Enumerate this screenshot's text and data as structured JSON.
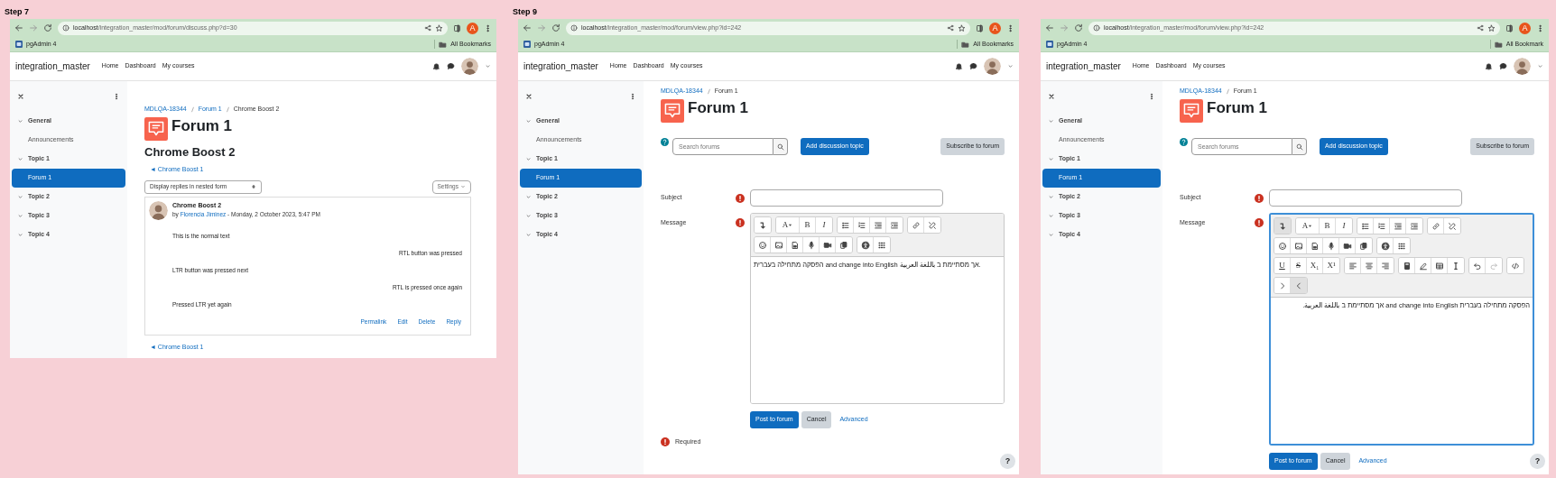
{
  "panels": [
    {
      "step_label": "Step 7",
      "browser": {
        "url_host": "localhost",
        "url_path": "/integration_master/mod/forum/discuss.php?d=30",
        "profile_initial": "A",
        "bookmark": "pgAdmin 4",
        "bookmarks_folder": "All Bookmarks"
      },
      "site": {
        "name": "integration_master",
        "nav": [
          "Home",
          "Dashboard",
          "My courses"
        ]
      },
      "sidebar": {
        "sections": [
          {
            "label": "General",
            "expanded": true,
            "children": [
              {
                "label": "Announcements",
                "selected": false
              }
            ]
          },
          {
            "label": "Topic 1",
            "expanded": true,
            "children": [
              {
                "label": "Forum 1",
                "selected": true
              }
            ]
          },
          {
            "label": "Topic 2",
            "expanded": true
          },
          {
            "label": "Topic 3",
            "expanded": true
          },
          {
            "label": "Topic 4",
            "expanded": true
          }
        ]
      },
      "breadcrumb": [
        {
          "label": "MDLQA-18344",
          "current": false
        },
        {
          "label": "Forum 1",
          "current": false
        },
        {
          "label": "Chrome Boost 2",
          "current": true
        }
      ],
      "page_title": "Forum 1",
      "content": {
        "kind": "discussion",
        "discussion_title": "Chrome Boost 2",
        "prev_link_top": "◄ Chrome Boost 1",
        "display_mode": "Display replies in nested form",
        "settings_button": "Settings",
        "post": {
          "subject": "Chrome Boost 2",
          "byline_prefix": "by ",
          "author": "Florencia Jiminez",
          "byline_suffix": " - Monday, 2 October 2023, 5:47 PM",
          "paragraphs": [
            {
              "text": "This is the normal text",
              "rtl": false
            },
            {
              "text": "RTL button was pressed",
              "rtl": true
            },
            {
              "text": "LTR button was pressed next",
              "rtl": false
            },
            {
              "text": "RTL is pressed once again",
              "rtl": true
            },
            {
              "text": "Pressed LTR yet again",
              "rtl": false
            }
          ],
          "actions": [
            "Permalink",
            "Edit",
            "Delete",
            "Reply"
          ]
        },
        "prev_link_bottom": "◄ Chrome Boost 1"
      }
    },
    {
      "step_label": "Step 9",
      "browser": {
        "url_host": "localhost",
        "url_path": "/integration_master/mod/forum/view.php?id=242",
        "profile_initial": "A",
        "bookmark": "pgAdmin 4",
        "bookmarks_folder": "All Bookmarks"
      },
      "site": {
        "name": "integration_master",
        "nav": [
          "Home",
          "Dashboard",
          "My courses"
        ]
      },
      "sidebar": {
        "sections": [
          {
            "label": "General",
            "expanded": true,
            "children": [
              {
                "label": "Announcements",
                "selected": false
              }
            ]
          },
          {
            "label": "Topic 1",
            "expanded": true,
            "children": [
              {
                "label": "Forum 1",
                "selected": true
              }
            ]
          },
          {
            "label": "Topic 2",
            "expanded": true
          },
          {
            "label": "Topic 3",
            "expanded": true
          },
          {
            "label": "Topic 4",
            "expanded": true
          }
        ]
      },
      "breadcrumb": [
        {
          "label": "MDLQA-18344",
          "current": false
        },
        {
          "label": "Forum 1",
          "current": true
        }
      ],
      "page_title": "Forum 1",
      "content": {
        "kind": "forum",
        "search_placeholder": "Search forums",
        "add_button": "Add discussion topic",
        "subscribe_button": "Subscribe to forum",
        "fields": [
          {
            "label": "Subject",
            "required": true,
            "kind": "text"
          },
          {
            "label": "Message",
            "required": true,
            "kind": "editor",
            "focused": false,
            "toolbar_expanded": false,
            "rtl": false,
            "text": "הפסקה מתחילה בעברית and change into English אך מסתיימת ב باللغة العربية.",
            "toolbar": [
              [
                [
                  {
                    "kind": "expand"
                  }
                ],
                [
                  {
                    "kind": "font",
                    "label": "A"
                  },
                  {
                    "kind": "bold",
                    "label": "B"
                  },
                  {
                    "kind": "italic",
                    "label": "I"
                  }
                ],
                [
                  {
                    "kind": "ul"
                  },
                  {
                    "kind": "ol"
                  },
                  {
                    "kind": "outdent"
                  },
                  {
                    "kind": "indent"
                  }
                ],
                [
                  {
                    "kind": "link"
                  },
                  {
                    "kind": "unlink"
                  }
                ]
              ],
              [
                [
                  {
                    "kind": "emoji"
                  },
                  {
                    "kind": "image"
                  },
                  {
                    "kind": "file"
                  },
                  {
                    "kind": "mic"
                  },
                  {
                    "kind": "video"
                  },
                  {
                    "kind": "copy"
                  }
                ],
                [
                  {
                    "kind": "accessibility"
                  },
                  {
                    "kind": "grid"
                  }
                ]
              ]
            ]
          }
        ],
        "post_button": "Post to forum",
        "cancel_button": "Cancel",
        "advanced_link": "Advanced",
        "required_note": "Required",
        "help_button": "?"
      }
    },
    {
      "browser": {
        "url_host": "localhost",
        "url_path": "/integration_master/mod/forum/view.php?id=242",
        "profile_initial": "A",
        "bookmark": "pgAdmin 4",
        "bookmarks_folder": "All Bookmark"
      },
      "site": {
        "name": "integration_master",
        "nav": [
          "Home",
          "Dashboard",
          "My courses"
        ]
      },
      "sidebar": {
        "sections": [
          {
            "label": "General",
            "expanded": true,
            "children": [
              {
                "label": "Announcements",
                "selected": false
              }
            ]
          },
          {
            "label": "Topic 1",
            "expanded": true,
            "children": [
              {
                "label": "Forum 1",
                "selected": true
              }
            ]
          },
          {
            "label": "Topic 2",
            "expanded": true
          },
          {
            "label": "Topic 3",
            "expanded": true
          },
          {
            "label": "Topic 4",
            "expanded": true
          }
        ]
      },
      "breadcrumb": [
        {
          "label": "MDLQA-18344",
          "current": false
        },
        {
          "label": "Forum 1",
          "current": true
        }
      ],
      "page_title": "Forum 1",
      "content": {
        "kind": "forum",
        "search_placeholder": "Search forums",
        "add_button": "Add discussion topic",
        "subscribe_button": "Subscribe to forum",
        "fields": [
          {
            "label": "Subject",
            "required": true,
            "kind": "text"
          },
          {
            "label": "Message",
            "required": true,
            "kind": "editor",
            "focused": true,
            "toolbar_expanded": true,
            "rtl": true,
            "text": "הפסקה מתחילה בעברית and change into English אך מסתיימת ב باللغة العربية.",
            "toolbar": [
              [
                [
                  {
                    "kind": "expand"
                  }
                ],
                [
                  {
                    "kind": "font",
                    "label": "A"
                  },
                  {
                    "kind": "bold",
                    "label": "B"
                  },
                  {
                    "kind": "italic",
                    "label": "I"
                  }
                ],
                [
                  {
                    "kind": "ul"
                  },
                  {
                    "kind": "ol"
                  },
                  {
                    "kind": "outdent"
                  },
                  {
                    "kind": "indent"
                  }
                ],
                [
                  {
                    "kind": "link"
                  },
                  {
                    "kind": "unlink"
                  }
                ]
              ],
              [
                [
                  {
                    "kind": "emoji"
                  },
                  {
                    "kind": "image"
                  },
                  {
                    "kind": "file"
                  },
                  {
                    "kind": "mic"
                  },
                  {
                    "kind": "video"
                  },
                  {
                    "kind": "copy"
                  }
                ],
                [
                  {
                    "kind": "accessibility"
                  },
                  {
                    "kind": "grid"
                  }
                ]
              ],
              [
                [
                  {
                    "kind": "underline",
                    "label": "U"
                  },
                  {
                    "kind": "strike",
                    "label": "S"
                  },
                  {
                    "kind": "sub",
                    "label": "X₁"
                  },
                  {
                    "kind": "sup",
                    "label": "X¹"
                  }
                ],
                [
                  {
                    "kind": "align-left"
                  },
                  {
                    "kind": "align-center"
                  },
                  {
                    "kind": "align-right"
                  }
                ],
                [
                  {
                    "kind": "calc"
                  },
                  {
                    "kind": "edit"
                  },
                  {
                    "kind": "table"
                  },
                  {
                    "kind": "cursor"
                  }
                ],
                [
                  {
                    "kind": "undo",
                    "disabled": false
                  },
                  {
                    "kind": "redo",
                    "disabled": true
                  }
                ],
                [
                  {
                    "kind": "code"
                  }
                ]
              ],
              [
                [
                  {
                    "kind": "ltr"
                  },
                  {
                    "kind": "rtl"
                  }
                ]
              ]
            ]
          }
        ],
        "post_button": "Post to forum",
        "cancel_button": "Cancel",
        "advanced_link": "Advanced",
        "help_button": "?"
      }
    }
  ]
}
